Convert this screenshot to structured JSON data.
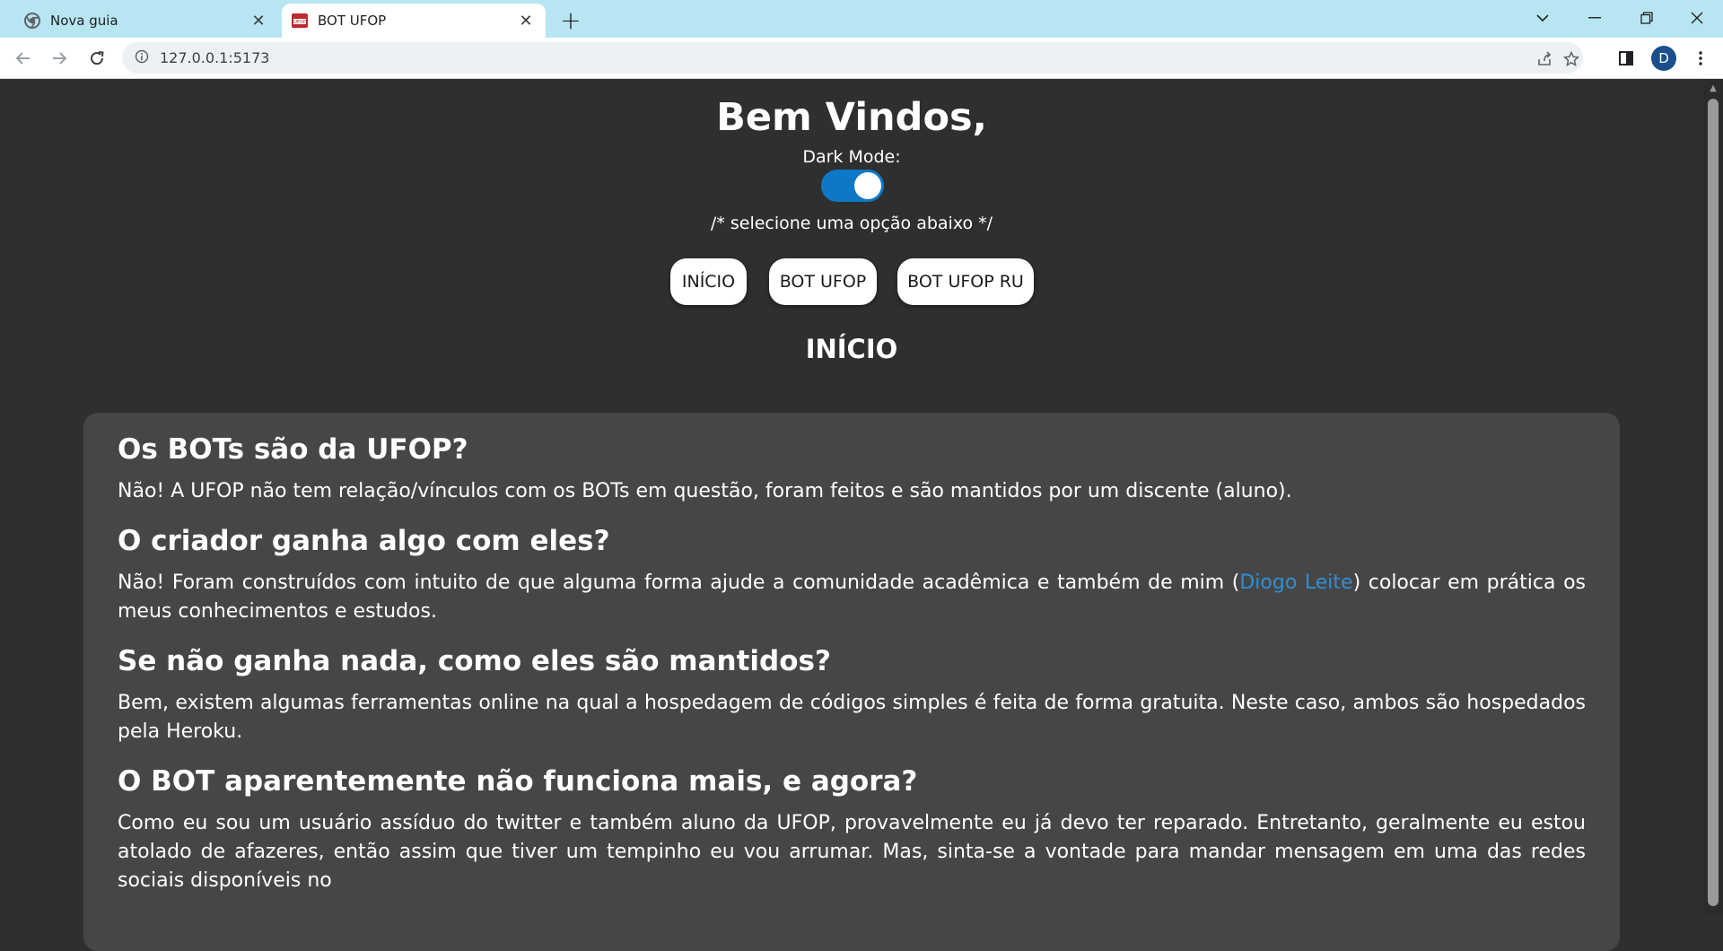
{
  "browser": {
    "tabs": [
      {
        "title": "Nova guia",
        "favicon": "chrome-icon",
        "active": false
      },
      {
        "title": "BOT UFOP",
        "favicon": "ufop-favicon",
        "active": true
      }
    ],
    "url": "127.0.0.1:5173",
    "profile_initial": "D"
  },
  "page": {
    "heading": "Bem Vindos,",
    "dark_mode_label": "Dark Mode:",
    "dark_mode_on": true,
    "hint": "/* selecione uma opção abaixo */",
    "nav": [
      "INÍCIO",
      "BOT UFOP",
      "BOT UFOP RU"
    ],
    "section_title": "INÍCIO",
    "faq": [
      {
        "q": "Os BOTs são da UFOP?",
        "a": "Não! A UFOP não tem relação/vínculos com os BOTs em questão, foram feitos e são mantidos por um discente (aluno)."
      },
      {
        "q": "O criador ganha algo com eles?",
        "a_before": "Não! Foram construídos com intuito de que alguma forma ajude a comunidade acadêmica e também de mim (",
        "a_link": "Diogo Leite",
        "a_after": ") colocar em prática os meus conhecimentos e estudos."
      },
      {
        "q": "Se não ganha nada, como eles são mantidos?",
        "a": "Bem, existem algumas ferramentas online na qual a hospedagem de códigos simples é feita de forma gratuita. Neste caso, ambos são hospedados pela Heroku."
      },
      {
        "q": "O BOT aparentemente não funciona mais, e agora?",
        "a": "Como eu sou um usuário assíduo do twitter e também aluno da UFOP, provavelmente eu já devo ter reparado. Entretanto, geralmente eu estou atolado de afazeres, então assim que tiver um tempinho eu vou arrumar. Mas, sinta-se a vontade para mandar mensagem em uma das redes sociais disponíveis no"
      }
    ]
  },
  "colors": {
    "toggle_on": "#0d79c6",
    "link": "#2f8fd4",
    "page_bg": "#2f2f2f",
    "card_bg": "#464646",
    "tabstrip_bg": "#b7e6f2"
  }
}
